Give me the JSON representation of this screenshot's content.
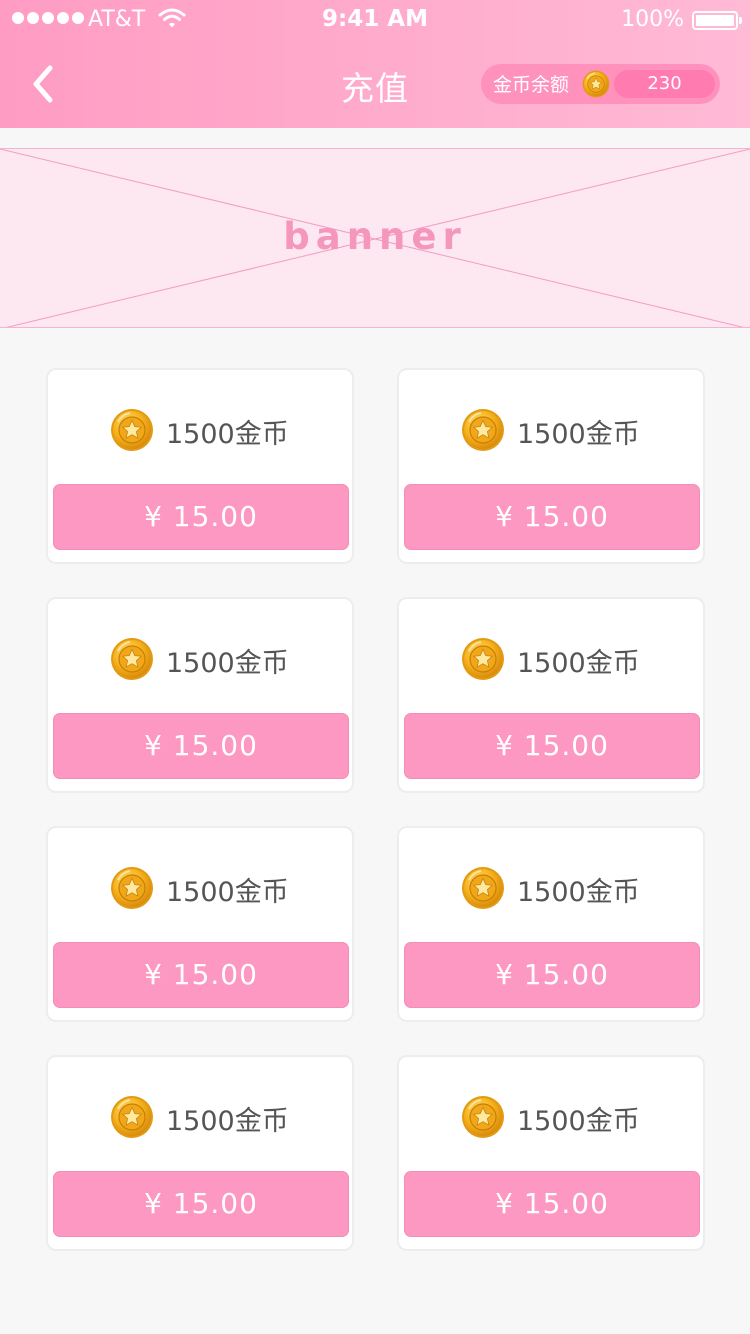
{
  "status_bar": {
    "carrier": "AT&T",
    "time": "9:41 AM",
    "battery": "100%"
  },
  "header": {
    "title": "充值",
    "balance_label": "金币余额",
    "balance_value": "230"
  },
  "banner": {
    "text": "banner"
  },
  "packages": [
    {
      "amount": "1500金币",
      "price": "¥ 15.00"
    },
    {
      "amount": "1500金币",
      "price": "¥ 15.00"
    },
    {
      "amount": "1500金币",
      "price": "¥ 15.00"
    },
    {
      "amount": "1500金币",
      "price": "¥ 15.00"
    },
    {
      "amount": "1500金币",
      "price": "¥ 15.00"
    },
    {
      "amount": "1500金币",
      "price": "¥ 15.00"
    },
    {
      "amount": "1500金币",
      "price": "¥ 15.00"
    },
    {
      "amount": "1500金币",
      "price": "¥ 15.00"
    }
  ],
  "colors": {
    "header": "#ff9cc3",
    "button": "#fc98c1",
    "banner_bg": "#fde7f0"
  },
  "icons": {
    "back": "chevron-left-icon",
    "coin": "gold-coin-star-icon"
  }
}
